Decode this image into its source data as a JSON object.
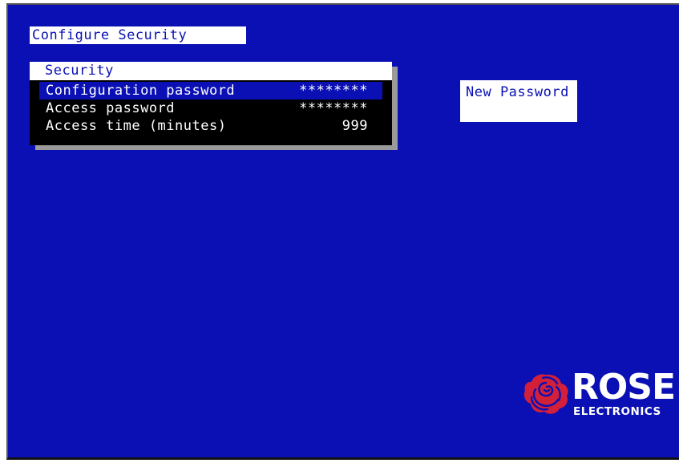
{
  "title": "Configure Security",
  "menu": {
    "header": "Security",
    "rows": [
      {
        "label": "Configuration password",
        "value": "********",
        "selected": true
      },
      {
        "label": "Access password",
        "value": "********",
        "selected": false
      },
      {
        "label": "Access time (minutes)",
        "value": "999",
        "selected": false
      }
    ]
  },
  "help_panel": {
    "text": "New Password"
  },
  "logo": {
    "word": "ROSE",
    "subtitle": "ELECTRONICS",
    "icon": "rose-icon"
  },
  "colors": {
    "background": "#0a10b4",
    "highlight": "#0a10b4",
    "panel": "#000000",
    "logo_red": "#d3203a"
  }
}
